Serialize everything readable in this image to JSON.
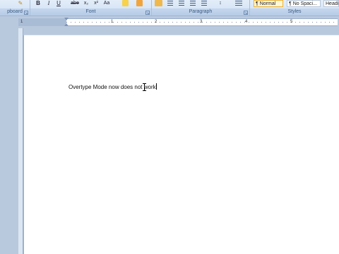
{
  "ribbon": {
    "groups": [
      {
        "label": "pboard"
      },
      {
        "label": "Font"
      },
      {
        "label": "Paragraph"
      },
      {
        "label": "Styles"
      }
    ],
    "font_buttons": [
      "B",
      "I",
      "U",
      "abe",
      "x₂",
      "x²",
      "Aa"
    ],
    "styles": [
      "¶ Normal",
      "¶ No Spaci...",
      "Headi"
    ]
  },
  "ruler": {
    "numbers": [
      "1",
      "1",
      "2",
      "3",
      "4",
      "5"
    ]
  },
  "document": {
    "text": "Overtype Mode now does not work"
  }
}
